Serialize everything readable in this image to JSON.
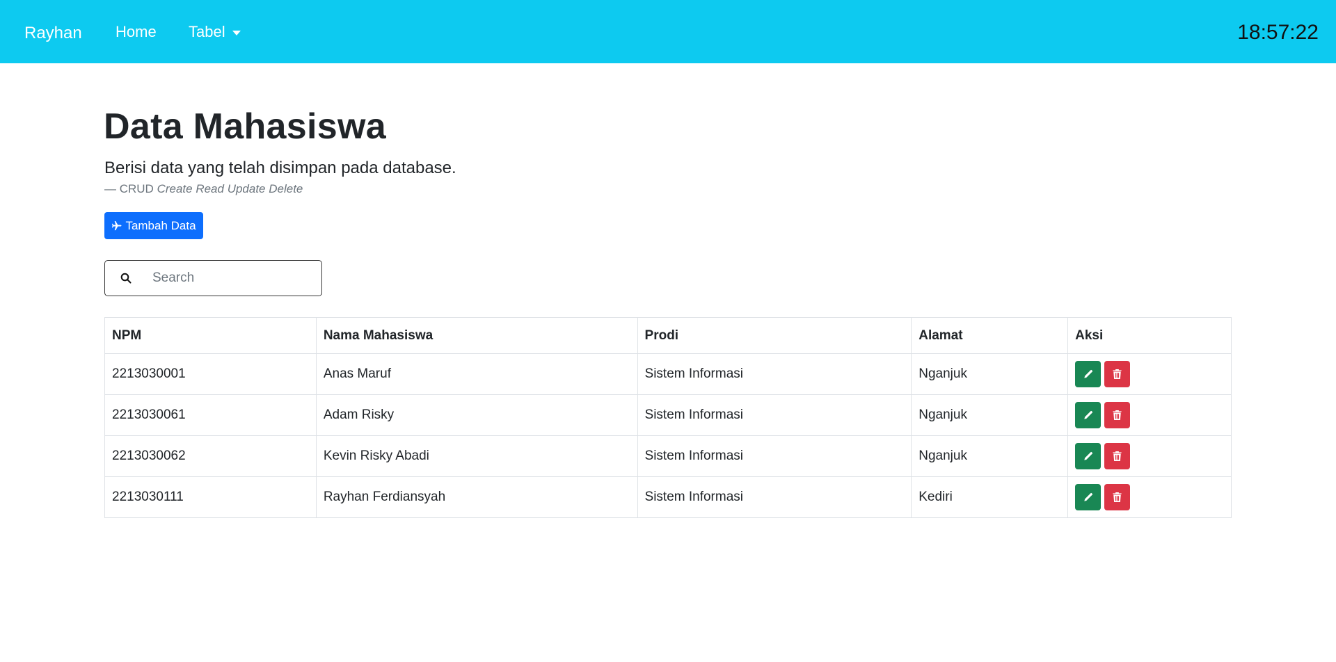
{
  "navbar": {
    "brand": "Rayhan",
    "links": [
      {
        "label": "Home"
      },
      {
        "label": "Tabel"
      }
    ],
    "clock": "18:57:22"
  },
  "header": {
    "title": "Data Mahasiswa",
    "lead": "Berisi data yang telah disimpan pada database.",
    "footer_prefix": "— CRUD",
    "footer_italic": "Create Read Update Delete"
  },
  "toolbar": {
    "add_label": "Tambah Data",
    "add_icon": "plane-icon"
  },
  "search": {
    "placeholder": "Search",
    "value": "",
    "icon": "search-icon"
  },
  "table": {
    "columns": [
      "NPM",
      "Nama Mahasiswa",
      "Prodi",
      "Alamat",
      "Aksi"
    ],
    "rows": [
      {
        "npm": "2213030001",
        "nama": "Anas Maruf",
        "prodi": "Sistem Informasi",
        "alamat": "Nganjuk"
      },
      {
        "npm": "2213030061",
        "nama": "Adam Risky",
        "prodi": "Sistem Informasi",
        "alamat": "Nganjuk"
      },
      {
        "npm": "2213030062",
        "nama": "Kevin Risky Abadi",
        "prodi": "Sistem Informasi",
        "alamat": "Nganjuk"
      },
      {
        "npm": "2213030111",
        "nama": "Rayhan Ferdiansyah",
        "prodi": "Sistem Informasi",
        "alamat": "Kediri"
      }
    ],
    "action_icons": [
      "pencil-icon",
      "trash-icon"
    ]
  },
  "colors": {
    "navbar": "#0dcaf0",
    "primary": "#0d6efd",
    "success": "#198754",
    "danger": "#dc3545"
  }
}
